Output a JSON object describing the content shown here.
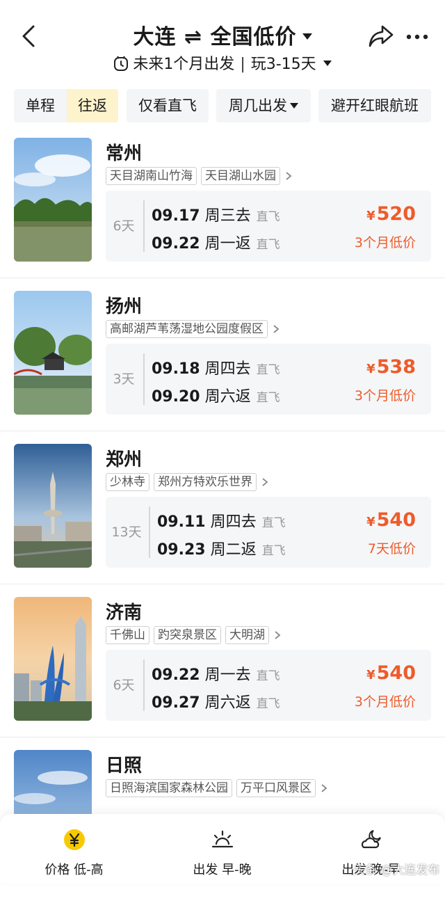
{
  "header": {
    "title": "大连 ⇌ 全国低价",
    "subtitle_range": "未来1个月出发",
    "subtitle_sep": "|",
    "subtitle_duration": "玩3-15天"
  },
  "filters": {
    "trip_oneway": "单程",
    "trip_round": "往返",
    "direct_only": "仅看直飞",
    "weekday": "周几出发",
    "avoid_redeye": "避开红眼航班"
  },
  "destinations": [
    {
      "city": "常州",
      "tags": [
        "天目湖南山竹海",
        "天目湖山水园"
      ],
      "days": "6天",
      "go": {
        "date": "09.17",
        "weekday": "周三去",
        "type": "直飞"
      },
      "back": {
        "date": "09.22",
        "weekday": "周一返",
        "type": "直飞"
      },
      "currency": "¥",
      "price": "520",
      "low_label": "3个月低价"
    },
    {
      "city": "扬州",
      "tags": [
        "高邮湖芦苇荡湿地公园度假区"
      ],
      "days": "3天",
      "go": {
        "date": "09.18",
        "weekday": "周四去",
        "type": "直飞"
      },
      "back": {
        "date": "09.20",
        "weekday": "周六返",
        "type": "直飞"
      },
      "currency": "¥",
      "price": "538",
      "low_label": "3个月低价"
    },
    {
      "city": "郑州",
      "tags": [
        "少林寺",
        "郑州方特欢乐世界"
      ],
      "days": "13天",
      "go": {
        "date": "09.11",
        "weekday": "周四去",
        "type": "直飞"
      },
      "back": {
        "date": "09.23",
        "weekday": "周二返",
        "type": "直飞"
      },
      "currency": "¥",
      "price": "540",
      "low_label": "7天低价"
    },
    {
      "city": "济南",
      "tags": [
        "千佛山",
        "趵突泉景区",
        "大明湖"
      ],
      "days": "6天",
      "go": {
        "date": "09.22",
        "weekday": "周一去",
        "type": "直飞"
      },
      "back": {
        "date": "09.27",
        "weekday": "周六返",
        "type": "直飞"
      },
      "currency": "¥",
      "price": "540",
      "low_label": "3个月低价"
    },
    {
      "city": "日照",
      "tags": [
        "日照海滨国家森林公园",
        "万平口风景区"
      ]
    }
  ],
  "tabbar": {
    "price_sort": "价格 低-高",
    "depart_sort": "出发 早-晚",
    "return_sort": "出发 晚-早"
  },
  "watermark": "头条 @大连发布",
  "colors": {
    "accent_price": "#ee5b2a",
    "selected_segment": "#fdf3cc",
    "panel_bg": "#f5f6f8",
    "yen_icon": "#f7c900"
  }
}
